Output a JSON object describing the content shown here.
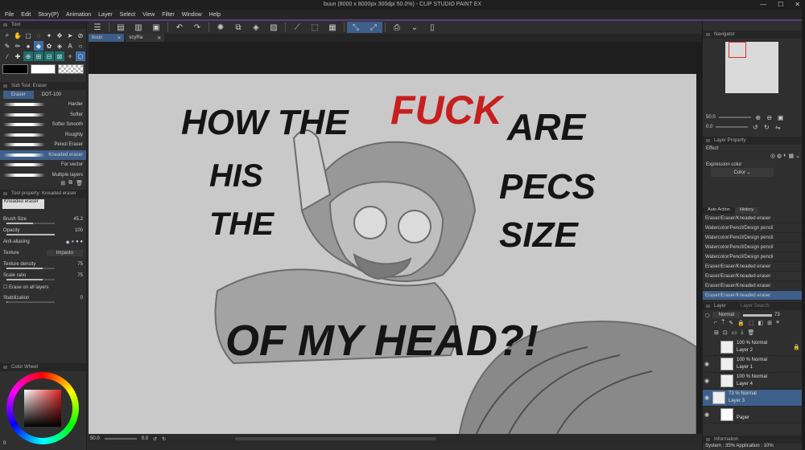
{
  "window": {
    "title": "buun (8000 x 8000px 300dpi 50.0%) - CLIP STUDIO PAINT EX"
  },
  "menu": [
    "File",
    "Edit",
    "Story(P)",
    "Animation",
    "Layer",
    "Select",
    "View",
    "Filter",
    "Window",
    "Help"
  ],
  "tabs": [
    {
      "label": "buun",
      "active": true
    },
    {
      "label": "scyRa",
      "active": false
    }
  ],
  "left": {
    "tool_header": "Tool",
    "subtool_header": "Sub Tool: Eraser",
    "subtool_tab": "Eraser",
    "subtool_tab2": "DOT-100",
    "brushes": [
      "Harder",
      "Softer",
      "Softer Smooth",
      "Roughly",
      "Pencil Eraser",
      "Kneaded eraser",
      "For vector",
      "Multiple layers"
    ],
    "selected_brush": "Kneaded eraser",
    "prop_header": "Tool property: Kneaded eraser",
    "prop_name": "Kneaded eraser",
    "brush_size_label": "Brush Size",
    "brush_size": "45.2",
    "opacity_label": "Opacity",
    "opacity": "100",
    "aa_label": "Anti-aliasing",
    "texture_label": "Texture",
    "texture_value": "Impasto",
    "tex_density_label": "Texture density",
    "tex_density": "75",
    "scale_label": "Scale ratio",
    "scale": "75",
    "erase_all_label": "Erase on all layers",
    "stab_label": "Stabilization",
    "stab": "0",
    "colorwheel_header": "Color Wheel",
    "color_readout": "0"
  },
  "status": {
    "zoom": "50.0",
    "angle": "0.0"
  },
  "right": {
    "navigator_header": "Navigator",
    "nav_zoom": "50.0",
    "nav_angle": "0.0",
    "layer_property_header": "Layer Property",
    "effect_label": "Effect",
    "expression_label": "Expression color",
    "expression_value": "Color",
    "history_tab1": "Auto Action",
    "history_tab2": "History",
    "history": [
      "Eraser/Eraser/Kneaded eraser",
      "Watercolor/Pencil/Design pencil",
      "Watercolor/Pencil/Design pencil",
      "Watercolor/Pencil/Design pencil",
      "Watercolor/Pencil/Design pencil",
      "Eraser/Eraser/Kneaded eraser",
      "Eraser/Eraser/Kneaded eraser",
      "Eraser/Eraser/Kneaded eraser",
      "Eraser/Eraser/Kneaded eraser"
    ],
    "layer_header": "Layer",
    "layer_header2": "Layer Search",
    "blend_mode": "Normal",
    "layer_opacity": "73",
    "layers": [
      {
        "opacity": "100 % Normal",
        "name": "Layer 2"
      },
      {
        "opacity": "100 % Normal",
        "name": "Layer 1"
      },
      {
        "opacity": "100 % Normal",
        "name": "Layer 4"
      },
      {
        "opacity": "73 % Normal",
        "name": "Layer 3"
      },
      {
        "opacity": "",
        "name": "Paper"
      }
    ],
    "info_header": "Information",
    "info_text": "System : 35%  Application : 10%"
  },
  "canvas_text": {
    "line1a": "HOW THE",
    "line1b": "FUCK",
    "line1c": "ARE",
    "his": "HIS",
    "pecs": "PECS",
    "the": "THE",
    "size": "SIZE",
    "bottom": "OF MY HEAD?!"
  },
  "colors": {
    "accent": "#3e5f8a",
    "red_text": "#c81e1e",
    "canvas_bg": "#c9c9c9"
  }
}
